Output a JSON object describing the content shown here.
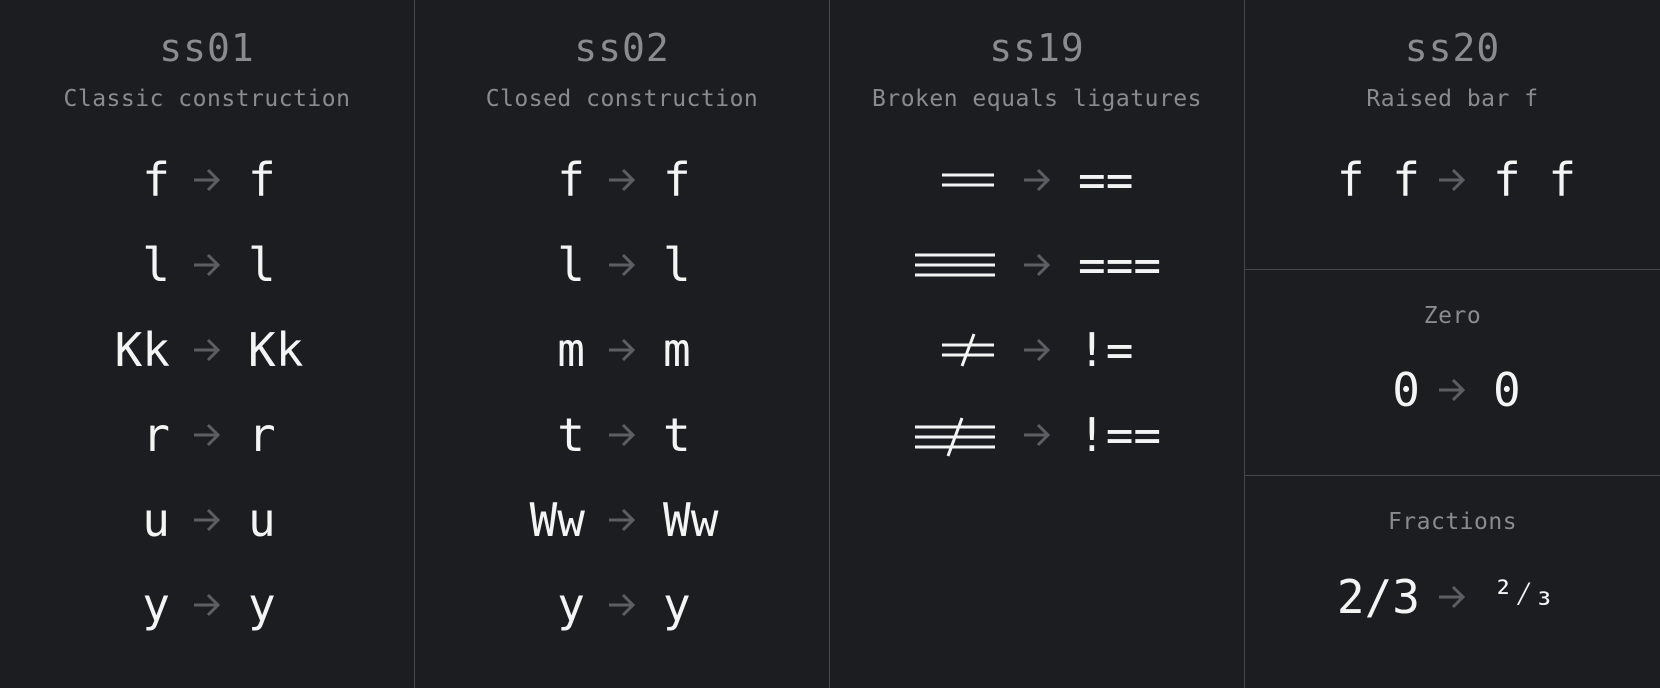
{
  "panels": [
    {
      "title": "ss01",
      "subtitle": "Classic construction",
      "rows": [
        {
          "from": "f",
          "to": "f"
        },
        {
          "from": "l",
          "to": "l"
        },
        {
          "from": "Kk",
          "to": "Kk"
        },
        {
          "from": "r",
          "to": "r"
        },
        {
          "from": "u",
          "to": "u"
        },
        {
          "from": "y",
          "to": "y"
        }
      ]
    },
    {
      "title": "ss02",
      "subtitle": "Closed construction",
      "rows": [
        {
          "from": "f",
          "to": "f"
        },
        {
          "from": "l",
          "to": "l"
        },
        {
          "from": "m",
          "to": "m"
        },
        {
          "from": "t",
          "to": "t"
        },
        {
          "from": "Ww",
          "to": "Ww"
        },
        {
          "from": "y",
          "to": "y"
        }
      ]
    },
    {
      "title": "ss19",
      "subtitle": "Broken equals ligatures",
      "rows": [
        {
          "from_glyph": "double-equals-ligature",
          "to": "=="
        },
        {
          "from_glyph": "triple-equals-ligature",
          "to": "==="
        },
        {
          "from_glyph": "not-equals-ligature",
          "to": "!="
        },
        {
          "from_glyph": "strict-not-equals-ligature",
          "to": "!=="
        }
      ]
    },
    {
      "title": "ss20",
      "subtitle": "Raised bar f",
      "rows": [
        {
          "from": "f f",
          "to": "f f"
        }
      ]
    },
    {
      "subtitle": "Zero",
      "rows": [
        {
          "from": "0",
          "to": "0"
        }
      ]
    },
    {
      "subtitle": "Fractions",
      "rows": [
        {
          "from": "2/3",
          "to": "²⁄₃"
        }
      ]
    }
  ],
  "colors": {
    "background": "#1c1d21",
    "divider": "#46474c",
    "heading": "#8a8b90",
    "glyph": "#f4f4f4",
    "arrow": "#5d5e63"
  },
  "icons": {
    "arrow": "right-arrow-icon"
  }
}
